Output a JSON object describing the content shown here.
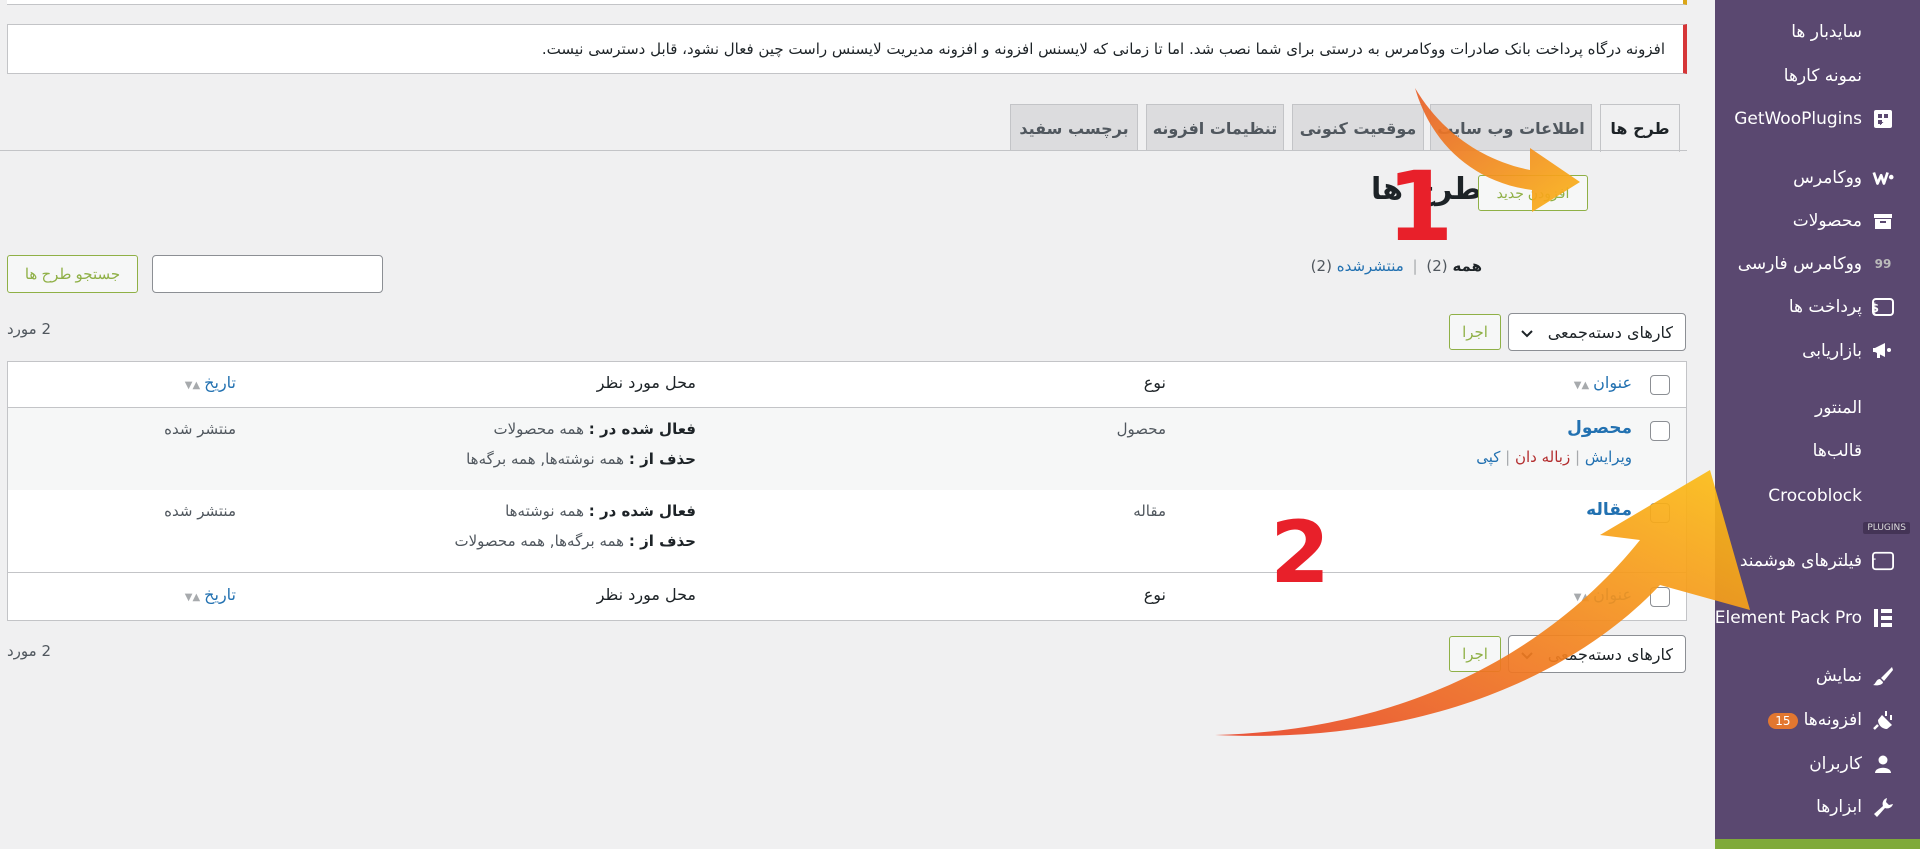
{
  "sidebar": {
    "items": [
      {
        "label": "سایدبار ها",
        "icon": "none"
      },
      {
        "label": "نمونه کارها",
        "icon": "none"
      },
      {
        "label": "GetWooPlugins",
        "icon": "plugins-grid-icon"
      },
      {
        "label": "ووکامرس",
        "icon": "woocommerce-icon"
      },
      {
        "label": "محصولات",
        "icon": "archive-box-icon"
      },
      {
        "label": "ووکامرس فارسی",
        "icon": "quote-99-icon"
      },
      {
        "label": "پرداخت ها",
        "icon": "dollar-card-icon"
      },
      {
        "label": "بازاریابی",
        "icon": "megaphone-icon"
      },
      {
        "label": "المنتور",
        "icon": "none"
      },
      {
        "label": "قالب‌ها",
        "icon": "none"
      },
      {
        "label": "Crocoblock",
        "icon": "crescent-icon"
      },
      {
        "label": "فیلترهای هوشمند",
        "icon": "jet-filter-icon"
      },
      {
        "label": "Element Pack Pro",
        "icon": "element-pack-icon"
      },
      {
        "label": "نمایش",
        "icon": "paintbrush-icon"
      },
      {
        "label": "افزونه‌ها",
        "icon": "plugin-plug-icon",
        "badge": "15"
      },
      {
        "label": "کاربران",
        "icon": "user-icon"
      },
      {
        "label": "ابزارها",
        "icon": "wrench-icon"
      }
    ],
    "mini_label": "PLUGINS",
    "accent": "#5a4870"
  },
  "notice": {
    "text": "افزونه درگاه پرداخت بانک صادرات ووکامرس به درستی برای شما نصب شد. اما تا زمانی که لایسنس افزونه و افزونه مدیریت لایسنس راست چین فعال نشود، قابل دسترسی نیست."
  },
  "tabs": [
    {
      "label": "طرح ها",
      "active": true
    },
    {
      "label": "اطلاعات وب سایت",
      "active": false
    },
    {
      "label": "موقعیت کنونی",
      "active": false
    },
    {
      "label": "تنظیمات افزونه",
      "active": false
    },
    {
      "label": "برچسب سفید",
      "active": false
    }
  ],
  "page": {
    "title": "طرح ها",
    "add_new": "افزودن جدید"
  },
  "filters": {
    "all_label": "همه",
    "all_count": "(2)",
    "sep": "|",
    "published_label": "منتشرشده",
    "published_count": "(2)"
  },
  "search": {
    "button": "جستجو طرح ها",
    "value": ""
  },
  "bulk": {
    "select_label": "کارهای دسته‌جمعی",
    "apply": "اجرا",
    "count": "2 مورد"
  },
  "table": {
    "headers": {
      "title": "عنوان",
      "type": "نوع",
      "location": "محل مورد نظر",
      "date": "تاریخ"
    },
    "rows": [
      {
        "title": "محصول",
        "actions": {
          "edit": "ویرایش",
          "trash": "زباله دان",
          "copy": "کپی"
        },
        "type": "محصول",
        "active_label": "فعال شده در :",
        "active_value": "همه محصولات",
        "exclude_label": "حذف از :",
        "exclude_value": "همه نوشته‌ها, همه برگه‌ها",
        "date": "منتشر شده"
      },
      {
        "title": "مقاله",
        "type": "مقاله",
        "active_label": "فعال شده در :",
        "active_value": "همه نوشته‌ها",
        "exclude_label": "حذف از :",
        "exclude_value": "همه برگه‌ها, همه محصولات",
        "date": "منتشر شده"
      }
    ]
  },
  "annotations": {
    "step1": "1",
    "step2": "2",
    "arrow_color": "#f39c1f",
    "number_color": "#e8202a"
  }
}
